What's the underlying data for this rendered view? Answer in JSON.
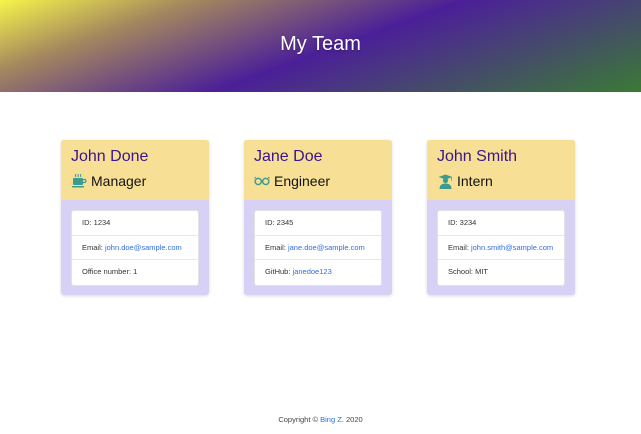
{
  "header": {
    "title": "My Team"
  },
  "cards": [
    {
      "name": "John Done",
      "role": "Manager",
      "role_icon": "coffee-mug-icon",
      "id": "ID: 1234",
      "email_label": "Email:",
      "email": "john.doe@sample.com",
      "extra": "Office number: 1"
    },
    {
      "name": "Jane Doe",
      "role": "Engineer",
      "role_icon": "glasses-icon",
      "id": "ID: 2345",
      "email_label": "Email:",
      "email": "jane.doe@sample.com",
      "extra_label": "GitHub:",
      "extra_link": "janedoe123"
    },
    {
      "name": "John Smith",
      "role": "Intern",
      "role_icon": "graduate-icon",
      "id": "ID: 3234",
      "email_label": "Email:",
      "email": "john.smith@sample.com",
      "extra": "School: MIT"
    }
  ],
  "footer": {
    "prefix": "Copyright ©",
    "author": "Bing Z.",
    "year": "2020"
  },
  "colors": {
    "card_header": "#f7e096",
    "card_body": "#d6d1f5",
    "name_text": "#3b148a",
    "link": "#2f6fde",
    "icon_teal": "#3d9b8e"
  }
}
